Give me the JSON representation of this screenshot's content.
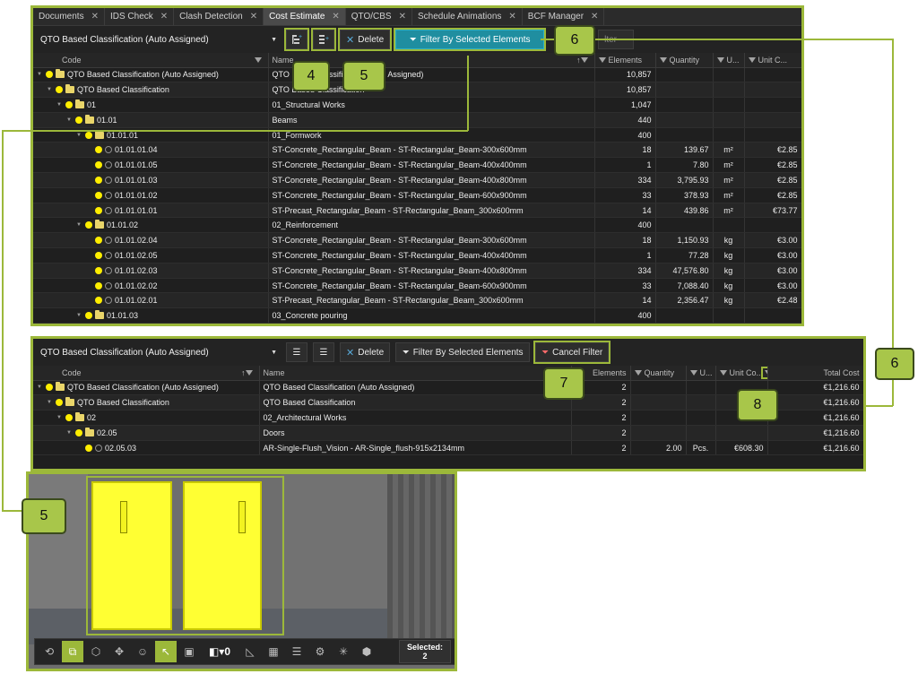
{
  "tabs": [
    {
      "label": "Documents"
    },
    {
      "label": "IDS Check"
    },
    {
      "label": "Clash Detection"
    },
    {
      "label": "Cost Estimate",
      "active": true
    },
    {
      "label": "QTO/CBS"
    },
    {
      "label": "Schedule Animations"
    },
    {
      "label": "BCF Manager"
    }
  ],
  "panel1": {
    "dropdown": "QTO Based Classification (Auto Assigned)",
    "delete_label": "Delete",
    "filter_label": "Filter By Selected Elements",
    "hidden_filter_fragment": "lter",
    "headers": {
      "code": "Code",
      "name": "Name",
      "elements": "Elements",
      "quantity": "Quantity",
      "unit": "U...",
      "unit_cost": "Unit C..."
    },
    "rows": [
      {
        "depth": 0,
        "kind": "folder",
        "expand": true,
        "code": "QTO Based Classification (Auto Assigned)",
        "name": "QTO Based Classification (Auto Assigned)",
        "elements": "10,857",
        "quantity": "",
        "unit": "",
        "unit_cost": ""
      },
      {
        "depth": 1,
        "kind": "folder",
        "expand": true,
        "code": "QTO Based Classification",
        "name": "QTO Based Classification",
        "elements": "10,857",
        "quantity": "",
        "unit": "",
        "unit_cost": ""
      },
      {
        "depth": 2,
        "kind": "folder",
        "expand": true,
        "code": "01",
        "name": "01_Structural Works",
        "elements": "1,047",
        "quantity": "",
        "unit": "",
        "unit_cost": ""
      },
      {
        "depth": 3,
        "kind": "folder",
        "expand": true,
        "code": "01.01",
        "name": "Beams",
        "elements": "440",
        "quantity": "",
        "unit": "",
        "unit_cost": ""
      },
      {
        "depth": 4,
        "kind": "folder",
        "expand": true,
        "code": "01.01.01",
        "name": "01_Formwork",
        "elements": "400",
        "quantity": "",
        "unit": "",
        "unit_cost": ""
      },
      {
        "depth": 5,
        "kind": "item",
        "code": "01.01.01.04",
        "name": "ST-Concrete_Rectangular_Beam - ST-Rectangular_Beam-300x600mm",
        "elements": "18",
        "quantity": "139.67",
        "unit": "m²",
        "unit_cost": "€2.85"
      },
      {
        "depth": 5,
        "kind": "item",
        "code": "01.01.01.05",
        "name": "ST-Concrete_Rectangular_Beam - ST-Rectangular_Beam-400x400mm",
        "elements": "1",
        "quantity": "7.80",
        "unit": "m²",
        "unit_cost": "€2.85"
      },
      {
        "depth": 5,
        "kind": "item",
        "code": "01.01.01.03",
        "name": "ST-Concrete_Rectangular_Beam - ST-Rectangular_Beam-400x800mm",
        "elements": "334",
        "quantity": "3,795.93",
        "unit": "m²",
        "unit_cost": "€2.85"
      },
      {
        "depth": 5,
        "kind": "item",
        "code": "01.01.01.02",
        "name": "ST-Concrete_Rectangular_Beam - ST-Rectangular_Beam-600x900mm",
        "elements": "33",
        "quantity": "378.93",
        "unit": "m²",
        "unit_cost": "€2.85"
      },
      {
        "depth": 5,
        "kind": "item",
        "code": "01.01.01.01",
        "name": "ST-Precast_Rectangular_Beam - ST-Rectangular_Beam_300x600mm",
        "elements": "14",
        "quantity": "439.86",
        "unit": "m²",
        "unit_cost": "€73.77"
      },
      {
        "depth": 4,
        "kind": "folder",
        "expand": true,
        "code": "01.01.02",
        "name": "02_Reinforcement",
        "elements": "400",
        "quantity": "",
        "unit": "",
        "unit_cost": ""
      },
      {
        "depth": 5,
        "kind": "item",
        "code": "01.01.02.04",
        "name": "ST-Concrete_Rectangular_Beam - ST-Rectangular_Beam-300x600mm",
        "elements": "18",
        "quantity": "1,150.93",
        "unit": "kg",
        "unit_cost": "€3.00"
      },
      {
        "depth": 5,
        "kind": "item",
        "code": "01.01.02.05",
        "name": "ST-Concrete_Rectangular_Beam - ST-Rectangular_Beam-400x400mm",
        "elements": "1",
        "quantity": "77.28",
        "unit": "kg",
        "unit_cost": "€3.00"
      },
      {
        "depth": 5,
        "kind": "item",
        "code": "01.01.02.03",
        "name": "ST-Concrete_Rectangular_Beam - ST-Rectangular_Beam-400x800mm",
        "elements": "334",
        "quantity": "47,576.80",
        "unit": "kg",
        "unit_cost": "€3.00"
      },
      {
        "depth": 5,
        "kind": "item",
        "code": "01.01.02.02",
        "name": "ST-Concrete_Rectangular_Beam - ST-Rectangular_Beam-600x900mm",
        "elements": "33",
        "quantity": "7,088.40",
        "unit": "kg",
        "unit_cost": "€3.00"
      },
      {
        "depth": 5,
        "kind": "item",
        "code": "01.01.02.01",
        "name": "ST-Precast_Rectangular_Beam - ST-Rectangular_Beam_300x600mm",
        "elements": "14",
        "quantity": "2,356.47",
        "unit": "kg",
        "unit_cost": "€2.48"
      },
      {
        "depth": 4,
        "kind": "folder",
        "expand": true,
        "code": "01.01.03",
        "name": "03_Concrete pouring",
        "elements": "400",
        "quantity": "",
        "unit": "",
        "unit_cost": ""
      }
    ]
  },
  "panel2": {
    "dropdown": "QTO Based Classification (Auto Assigned)",
    "delete_label": "Delete",
    "filter_label": "Filter By Selected Elements",
    "cancel_label": "Cancel Filter",
    "headers": {
      "code": "Code",
      "name": "Name",
      "elements": "Elements",
      "quantity": "Quantity",
      "unit": "U...",
      "unit_cost": "Unit Co...",
      "total_cost": "Total Cost"
    },
    "rows": [
      {
        "depth": 0,
        "kind": "folder",
        "code": "QTO Based Classification (Auto Assigned)",
        "name": "QTO Based Classification (Auto Assigned)",
        "elements": "2",
        "quantity": "",
        "unit": "",
        "unit_cost": "",
        "total_cost": "€1,216.60"
      },
      {
        "depth": 1,
        "kind": "folder",
        "code": "QTO Based Classification",
        "name": "QTO Based Classification",
        "elements": "2",
        "quantity": "",
        "unit": "",
        "unit_cost": "",
        "total_cost": "€1,216.60"
      },
      {
        "depth": 2,
        "kind": "folder",
        "code": "02",
        "name": "02_Architectural Works",
        "elements": "2",
        "quantity": "",
        "unit": "",
        "unit_cost": "",
        "total_cost": "€1,216.60"
      },
      {
        "depth": 3,
        "kind": "folder",
        "code": "02.05",
        "name": "Doors",
        "elements": "2",
        "quantity": "",
        "unit": "",
        "unit_cost": "",
        "total_cost": "€1,216.60"
      },
      {
        "depth": 4,
        "kind": "item",
        "code": "02.05.03",
        "name": "AR-Single-Flush_Vision - AR-Single_flush-915x2134mm",
        "elements": "2",
        "quantity": "2.00",
        "unit": "Pcs.",
        "unit_cost": "€608.30",
        "total_cost": "€1,216.60"
      }
    ]
  },
  "viewer": {
    "selected_label": "Selected:",
    "selected_count": "2",
    "visibility_count": "0"
  },
  "callouts": {
    "c4": "4",
    "c5a": "5",
    "c6a": "6",
    "c6b": "6",
    "c7": "7",
    "c8": "8",
    "c5b": "5"
  },
  "colors": {
    "accent": "#9cb83a",
    "filter_blue": "#1f8ea0",
    "selection_yellow": "#ffff33"
  }
}
